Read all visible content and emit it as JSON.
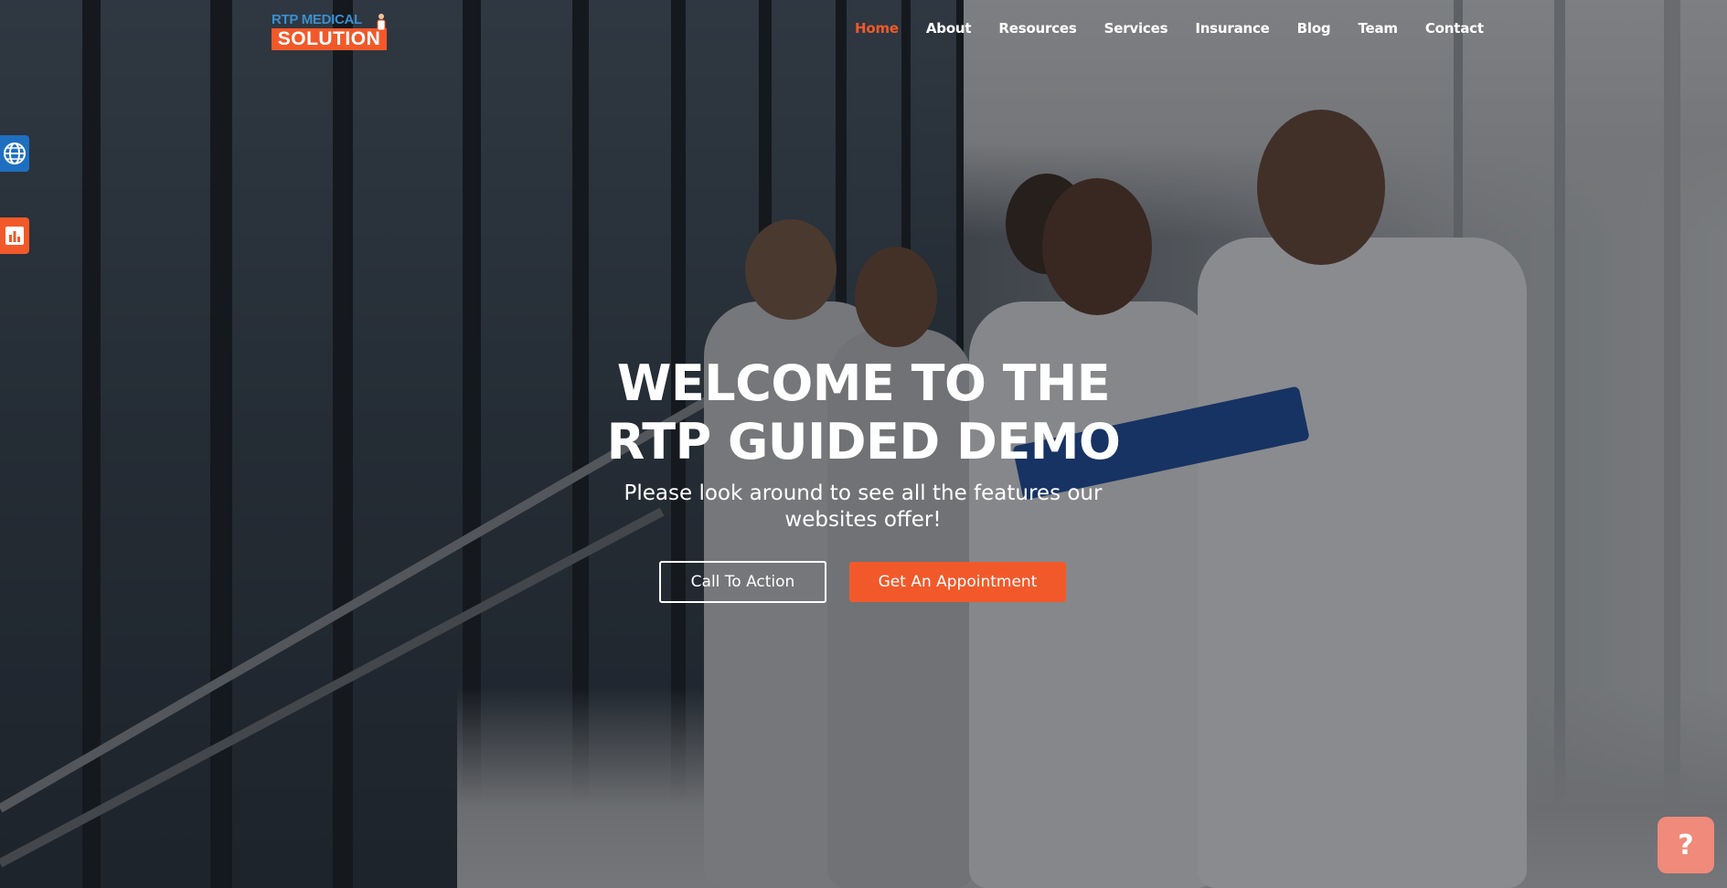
{
  "brand": {
    "logo_top": "RTP MEDICAL",
    "logo_bottom": "SOLUTION",
    "accent_color": "#f2592a",
    "logo_blue": "#3a8fd0"
  },
  "nav": {
    "items": [
      {
        "label": "Home",
        "active": true
      },
      {
        "label": "About",
        "active": false
      },
      {
        "label": "Resources",
        "active": false
      },
      {
        "label": "Services",
        "active": false
      },
      {
        "label": "Insurance",
        "active": false
      },
      {
        "label": "Blog",
        "active": false
      },
      {
        "label": "Team",
        "active": false
      },
      {
        "label": "Contact",
        "active": false
      }
    ]
  },
  "side_widgets": {
    "globe_icon": "globe-icon",
    "stats_icon": "bar-chart-icon",
    "globe_color": "#1e6fc0",
    "stats_color": "#f2592a"
  },
  "hero": {
    "title_line1": "WELCOME TO THE",
    "title_line2": "RTP GUIDED DEMO",
    "subtitle": "Please look around to see all the features our websites offer!",
    "cta_outline_label": "Call To Action",
    "cta_solid_label": "Get An Appointment"
  },
  "help": {
    "label": "?",
    "color": "#f08a7a"
  }
}
